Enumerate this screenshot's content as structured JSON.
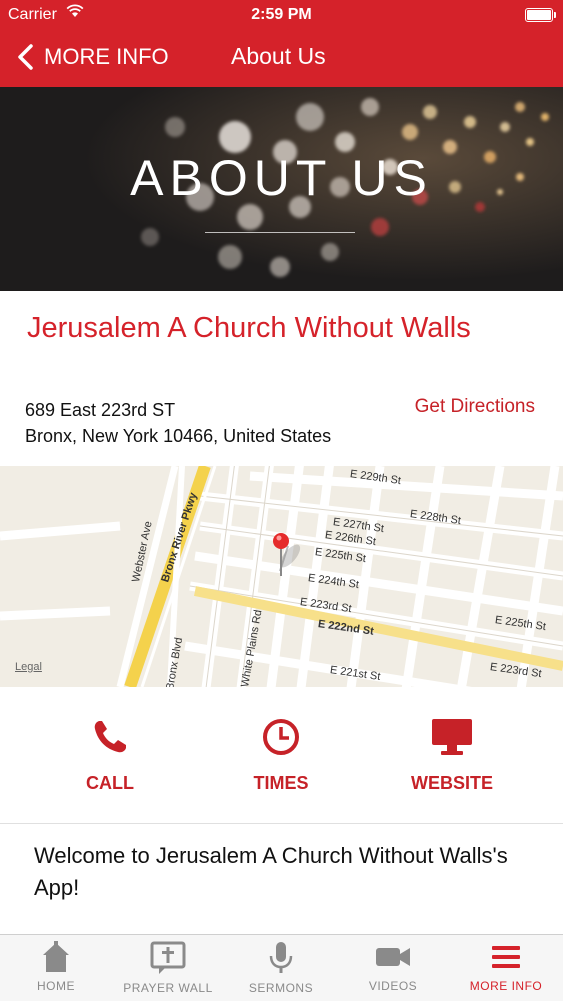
{
  "status_bar": {
    "carrier": "Carrier",
    "time": "2:59 PM"
  },
  "nav": {
    "back_label": "MORE INFO",
    "title": "About Us"
  },
  "hero": {
    "title": "ABOUT US"
  },
  "church": {
    "name": "Jerusalem A Church Without Walls",
    "address_line1": "689 East 223rd ST",
    "address_line2": "Bronx, New York 10466, United States",
    "directions_label": "Get Directions"
  },
  "map": {
    "legal": "Legal",
    "street_labels": [
      "E 229th St",
      "E 228th St",
      "E 227th St",
      "E 226th St",
      "E 225th St",
      "E 224th St",
      "E 223rd St",
      "E 222nd St",
      "E 221st St",
      "Webster Ave",
      "Bronx River Pkwy",
      "White Plains Rd",
      "Bronx Blvd",
      "E 225th St",
      "E 223rd St"
    ]
  },
  "actions": [
    {
      "label": "CALL",
      "icon": "phone-icon"
    },
    {
      "label": "TIMES",
      "icon": "clock-icon"
    },
    {
      "label": "WEBSITE",
      "icon": "monitor-icon"
    }
  ],
  "welcome_text": "Welcome to Jerusalem A Church Without Walls's App!",
  "tabs": [
    {
      "label": "HOME",
      "icon": "church-icon"
    },
    {
      "label": "PRAYER WALL",
      "icon": "prayer-bubble-icon"
    },
    {
      "label": "SERMONS",
      "icon": "microphone-icon"
    },
    {
      "label": "VIDEOS",
      "icon": "video-camera-icon"
    },
    {
      "label": "MORE INFO",
      "icon": "menu-icon"
    }
  ],
  "colors": {
    "accent": "#d5222a",
    "tab_inactive": "#8a8a8a"
  }
}
